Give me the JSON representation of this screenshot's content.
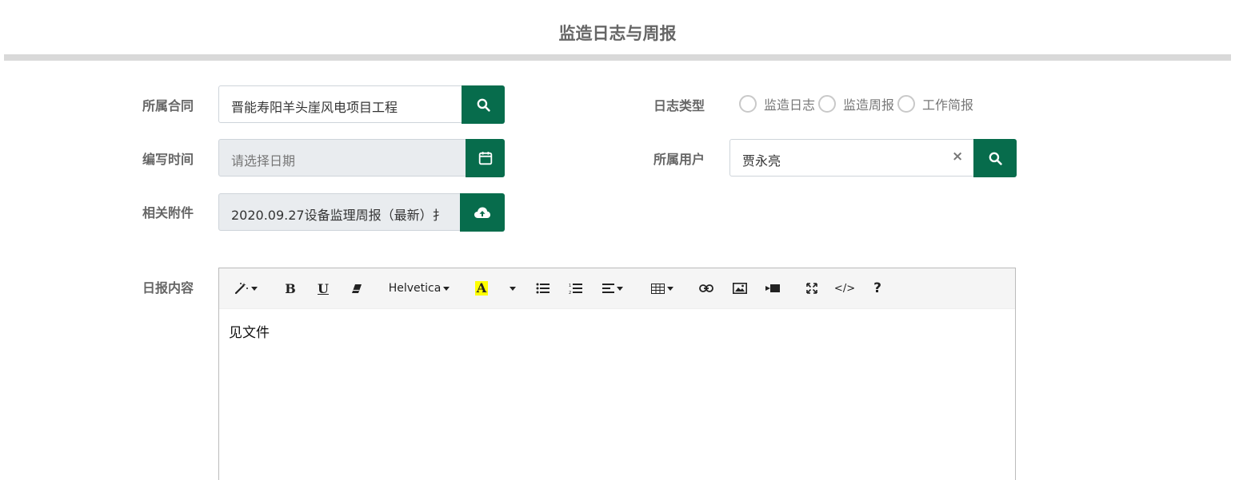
{
  "page_title": "监造日志与周报",
  "form": {
    "contract": {
      "label": "所属合同",
      "value": "晋能寿阳羊头崖风电项目工程"
    },
    "write_time": {
      "label": "编写时间",
      "placeholder": "请选择日期"
    },
    "attachment": {
      "label": "相关附件",
      "value": "2020.09.27设备监理周报（最新）扌"
    },
    "log_type": {
      "label": "日志类型",
      "options": [
        "监造日志",
        "监造周报",
        "工作简报"
      ]
    },
    "user": {
      "label": "所属用户",
      "value": "贾永亮",
      "clear": "×"
    },
    "content": {
      "label": "日报内容",
      "value": "见文件"
    }
  },
  "toolbar": {
    "bold": "B",
    "underline": "U",
    "font_name": "Helvetica",
    "forecolor": "A",
    "help": "?",
    "code": "</>"
  },
  "colors": {
    "accent": "#076c4c",
    "highlight": "#ffff00"
  }
}
